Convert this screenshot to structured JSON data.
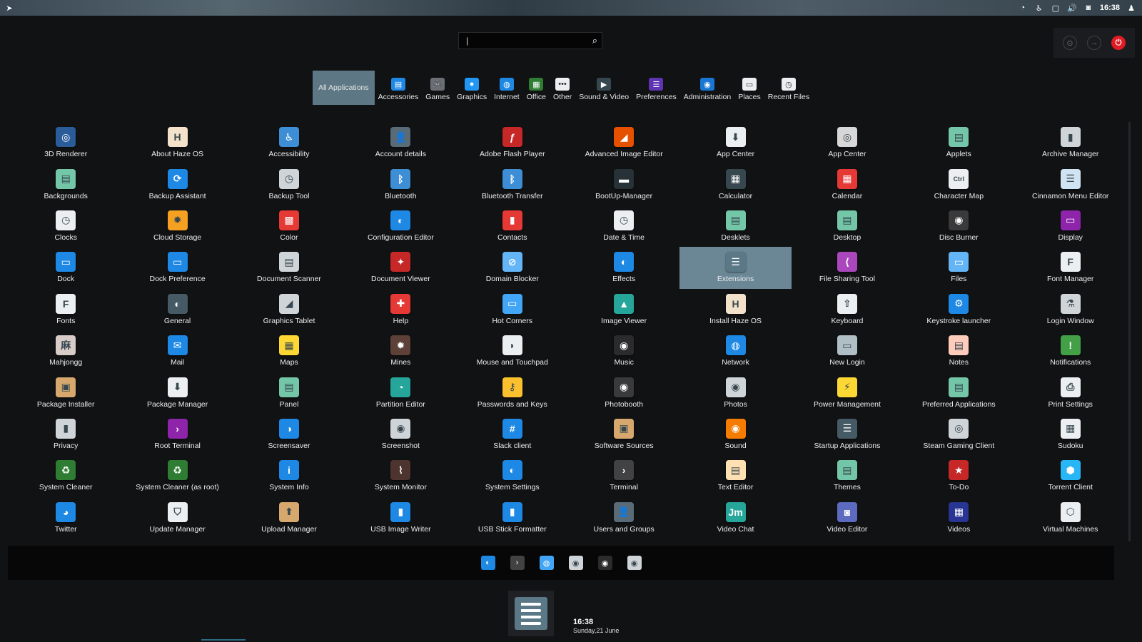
{
  "topbar": {
    "time": "16:38",
    "icons": [
      "cursor-icon",
      "update-icon",
      "accessibility-icon",
      "window-icon",
      "volume-icon",
      "camera-icon",
      "user-icon"
    ]
  },
  "search": {
    "value": "|",
    "placeholder": ""
  },
  "session_buttons": [
    "lock-icon",
    "logout-icon",
    "power-icon"
  ],
  "categories": [
    {
      "label": "All Applications",
      "icon": "",
      "color": "#5d7785",
      "active": true
    },
    {
      "label": "Accessories",
      "icon": "▤",
      "color": "#1e88e5"
    },
    {
      "label": "Games",
      "icon": "🎮",
      "color": "#6b6f75"
    },
    {
      "label": "Graphics",
      "icon": "●",
      "color": "#2196f3"
    },
    {
      "label": "Internet",
      "icon": "◍",
      "color": "#1e88e5"
    },
    {
      "label": "Office",
      "icon": "▦",
      "color": "#2e7d32"
    },
    {
      "label": "Other",
      "icon": "•••",
      "color": "#eceff1"
    },
    {
      "label": "Sound & Video",
      "icon": "▶",
      "color": "#37474f"
    },
    {
      "label": "Preferences",
      "icon": "☰",
      "color": "#5e35b1"
    },
    {
      "label": "Administration",
      "icon": "◉",
      "color": "#1976d2"
    },
    {
      "label": "Places",
      "icon": "▭",
      "color": "#eceff1"
    },
    {
      "label": "Recent Files",
      "icon": "◷",
      "color": "#eceff1"
    }
  ],
  "apps": [
    {
      "label": "3D Renderer",
      "icon": "◎",
      "color": "#2a5c9a"
    },
    {
      "label": "About Haze OS",
      "icon": "H",
      "color": "#f3e2c9"
    },
    {
      "label": "Accessibility",
      "icon": "♿",
      "color": "#3d8ed4"
    },
    {
      "label": "Account details",
      "icon": "👤",
      "color": "#5a6b78"
    },
    {
      "label": "Adobe Flash Player",
      "icon": "ƒ",
      "color": "#c62828"
    },
    {
      "label": "Advanced Image Editor",
      "icon": "◢",
      "color": "#e65100"
    },
    {
      "label": "App Center",
      "icon": "⬇",
      "color": "#eceff1"
    },
    {
      "label": "App Center",
      "icon": "◎",
      "color": "#d7d7d7"
    },
    {
      "label": "Applets",
      "icon": "▤",
      "color": "#74c6a8"
    },
    {
      "label": "Archive Manager",
      "icon": "▮",
      "color": "#cfd4d8"
    },
    {
      "label": "Backgrounds",
      "icon": "▤",
      "color": "#74c6a8"
    },
    {
      "label": "Backup Assistant",
      "icon": "⟳",
      "color": "#1e88e5"
    },
    {
      "label": "Backup Tool",
      "icon": "◷",
      "color": "#cfd4d8"
    },
    {
      "label": "Bluetooth",
      "icon": "ᛒ",
      "color": "#3d8ed4"
    },
    {
      "label": "Bluetooth Transfer",
      "icon": "ᛒ",
      "color": "#3d8ed4"
    },
    {
      "label": "BootUp-Manager",
      "icon": "▬",
      "color": "#263238"
    },
    {
      "label": "Calculator",
      "icon": "▦",
      "color": "#37474f"
    },
    {
      "label": "Calendar",
      "icon": "▦",
      "color": "#e53935"
    },
    {
      "label": "Character Map",
      "icon": "Ctrl",
      "color": "#eceff1"
    },
    {
      "label": "Cinnamon Menu Editor",
      "icon": "☰",
      "color": "#cfe3f2"
    },
    {
      "label": "Clocks",
      "icon": "◷",
      "color": "#eceff1"
    },
    {
      "label": "Cloud Storage",
      "icon": "✹",
      "color": "#f4a020"
    },
    {
      "label": "Color",
      "icon": "▩",
      "color": "#e53935"
    },
    {
      "label": "Configuration Editor",
      "icon": "◐",
      "color": "#1e88e5"
    },
    {
      "label": "Contacts",
      "icon": "▮",
      "color": "#e53935"
    },
    {
      "label": "Date & Time",
      "icon": "◷",
      "color": "#eceff1"
    },
    {
      "label": "Desklets",
      "icon": "▤",
      "color": "#74c6a8"
    },
    {
      "label": "Desktop",
      "icon": "▤",
      "color": "#74c6a8"
    },
    {
      "label": "Disc Burner",
      "icon": "◉",
      "color": "#3a3a3a"
    },
    {
      "label": "Display",
      "icon": "▭",
      "color": "#8e24aa"
    },
    {
      "label": "Dock",
      "icon": "▭",
      "color": "#1e88e5"
    },
    {
      "label": "Dock Preference",
      "icon": "▭",
      "color": "#1e88e5"
    },
    {
      "label": "Document Scanner",
      "icon": "▤",
      "color": "#cfd4d8"
    },
    {
      "label": "Document Viewer",
      "icon": "✦",
      "color": "#c62828"
    },
    {
      "label": "Domain Blocker",
      "icon": "⊘",
      "color": "#64b5f6"
    },
    {
      "label": "Effects",
      "icon": "◐",
      "color": "#1e88e5"
    },
    {
      "label": "Extensions",
      "icon": "☰",
      "color": "#5b7887",
      "selected": true
    },
    {
      "label": "File Sharing Tool",
      "icon": "⟨",
      "color": "#ab47bc"
    },
    {
      "label": "Files",
      "icon": "▭",
      "color": "#64b5f6"
    },
    {
      "label": "Font Manager",
      "icon": "F",
      "color": "#eceff1"
    },
    {
      "label": "Fonts",
      "icon": "F",
      "color": "#eceff1"
    },
    {
      "label": "General",
      "icon": "◐",
      "color": "#455a64"
    },
    {
      "label": "Graphics Tablet",
      "icon": "◢",
      "color": "#cfd4d8"
    },
    {
      "label": "Help",
      "icon": "✚",
      "color": "#e53935"
    },
    {
      "label": "Hot Corners",
      "icon": "▭",
      "color": "#42a5f5"
    },
    {
      "label": "Image Viewer",
      "icon": "▲",
      "color": "#26a69a"
    },
    {
      "label": "Install Haze OS",
      "icon": "H",
      "color": "#f3e2c9"
    },
    {
      "label": "Keyboard",
      "icon": "⇧",
      "color": "#eceff1"
    },
    {
      "label": "Keystroke launcher",
      "icon": "⚙",
      "color": "#1e88e5"
    },
    {
      "label": "Login Window",
      "icon": "⚗",
      "color": "#cfd4d8"
    },
    {
      "label": "Mahjongg",
      "icon": "麻",
      "color": "#d7ccc8"
    },
    {
      "label": "Mail",
      "icon": "✉",
      "color": "#1e88e5"
    },
    {
      "label": "Maps",
      "icon": "▦",
      "color": "#fdd835"
    },
    {
      "label": "Mines",
      "icon": "✹",
      "color": "#5d4037"
    },
    {
      "label": "Mouse and Touchpad",
      "icon": "◗",
      "color": "#eceff1"
    },
    {
      "label": "Music",
      "icon": "◉",
      "color": "#2b2b2b"
    },
    {
      "label": "Network",
      "icon": "◍",
      "color": "#1e88e5"
    },
    {
      "label": "New Login",
      "icon": "▭",
      "color": "#b0bec5"
    },
    {
      "label": "Notes",
      "icon": "▤",
      "color": "#ffccbc"
    },
    {
      "label": "Notifications",
      "icon": "!",
      "color": "#43a047"
    },
    {
      "label": "Package Installer",
      "icon": "▣",
      "color": "#d7a86e"
    },
    {
      "label": "Package Manager",
      "icon": "⬇",
      "color": "#eceff1"
    },
    {
      "label": "Panel",
      "icon": "▤",
      "color": "#74c6a8"
    },
    {
      "label": "Partition Editor",
      "icon": "◔",
      "color": "#26a69a"
    },
    {
      "label": "Passwords and Keys",
      "icon": "⚷",
      "color": "#fbc02d"
    },
    {
      "label": "Photobooth",
      "icon": "◉",
      "color": "#3a3a3a"
    },
    {
      "label": "Photos",
      "icon": "◉",
      "color": "#cfd4d8"
    },
    {
      "label": "Power Management",
      "icon": "⚡",
      "color": "#fdd835"
    },
    {
      "label": "Preferred Applications",
      "icon": "▤",
      "color": "#74c6a8"
    },
    {
      "label": "Print Settings",
      "icon": "⎙",
      "color": "#eceff1"
    },
    {
      "label": "Privacy",
      "icon": "▮",
      "color": "#cfd4d8"
    },
    {
      "label": "Root Terminal",
      "icon": "›",
      "color": "#8e24aa"
    },
    {
      "label": "Screensaver",
      "icon": "◑",
      "color": "#1e88e5"
    },
    {
      "label": "Screenshot",
      "icon": "◉",
      "color": "#cfd4d8"
    },
    {
      "label": "Slack client",
      "icon": "#",
      "color": "#1e88e5"
    },
    {
      "label": "Software Sources",
      "icon": "▣",
      "color": "#d7a86e"
    },
    {
      "label": "Sound",
      "icon": "◉",
      "color": "#f57c00"
    },
    {
      "label": "Startup Applications",
      "icon": "☰",
      "color": "#455a64"
    },
    {
      "label": "Steam Gaming Client",
      "icon": "◎",
      "color": "#cfd4d8"
    },
    {
      "label": "Sudoku",
      "icon": "▦",
      "color": "#eceff1"
    },
    {
      "label": "System Cleaner",
      "icon": "♻",
      "color": "#2e7d32"
    },
    {
      "label": "System Cleaner (as root)",
      "icon": "♻",
      "color": "#2e7d32"
    },
    {
      "label": "System Info",
      "icon": "i",
      "color": "#1e88e5"
    },
    {
      "label": "System Monitor",
      "icon": "⌇",
      "color": "#4e342e"
    },
    {
      "label": "System Settings",
      "icon": "◐",
      "color": "#1e88e5"
    },
    {
      "label": "Terminal",
      "icon": "›",
      "color": "#424242"
    },
    {
      "label": "Text Editor",
      "icon": "▤",
      "color": "#ffe0b2"
    },
    {
      "label": "Themes",
      "icon": "▤",
      "color": "#74c6a8"
    },
    {
      "label": "To-Do",
      "icon": "★",
      "color": "#c62828"
    },
    {
      "label": "Torrent Client",
      "icon": "⬢",
      "color": "#29b6f6"
    },
    {
      "label": "Twitter",
      "icon": "◕",
      "color": "#1e88e5"
    },
    {
      "label": "Update Manager",
      "icon": "⛉",
      "color": "#eceff1"
    },
    {
      "label": "Upload Manager",
      "icon": "⬆",
      "color": "#d7a86e"
    },
    {
      "label": "USB Image Writer",
      "icon": "▮",
      "color": "#1e88e5"
    },
    {
      "label": "USB Stick Formatter",
      "icon": "▮",
      "color": "#1e88e5"
    },
    {
      "label": "Users and Groups",
      "icon": "👤",
      "color": "#5a6b78"
    },
    {
      "label": "Video Chat",
      "icon": "Jm",
      "color": "#26a69a"
    },
    {
      "label": "Video Editor",
      "icon": "◙",
      "color": "#5c6bc0"
    },
    {
      "label": "Videos",
      "icon": "▦",
      "color": "#283593"
    },
    {
      "label": "Virtual Machines",
      "icon": "⬡",
      "color": "#eceff1"
    }
  ],
  "favorites": [
    {
      "icon": "◐",
      "color": "#1e88e5",
      "name": "system-settings-fav-icon"
    },
    {
      "icon": "›",
      "color": "#424242",
      "name": "terminal-fav-icon"
    },
    {
      "icon": "◍",
      "color": "#42a5f5",
      "name": "browser-fav-icon"
    },
    {
      "icon": "◉",
      "color": "#cfd4d8",
      "name": "screenshot-fav-icon"
    },
    {
      "icon": "◉",
      "color": "#2b2b2b",
      "name": "music-fav-icon"
    },
    {
      "icon": "◉",
      "color": "#cfd4d8",
      "name": "camera-fav-icon"
    }
  ],
  "clock": {
    "time": "16:38",
    "date": "Sunday,21 June"
  }
}
